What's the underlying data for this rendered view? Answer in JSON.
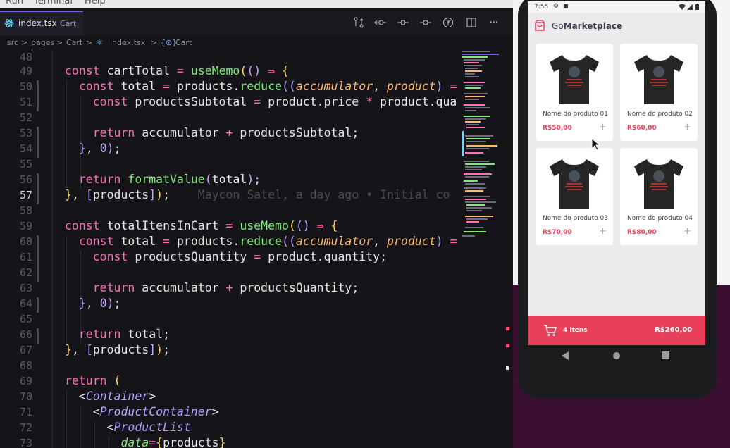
{
  "menu": [
    "Run",
    "Terminal",
    "Help"
  ],
  "tab": {
    "file_name": "index.tsx",
    "description": "Cart"
  },
  "toolbar_icons": [
    "git-compare-icon",
    "go-back-icon",
    "timeline-dot-icon",
    "timeline-dot-icon-2",
    "source-control-icon",
    "split-editor-icon",
    "more-actions-icon"
  ],
  "breadcrumb": [
    "src",
    ">",
    "pages",
    ">",
    "Cart",
    ">",
    "index.tsx",
    ">",
    "Cart"
  ],
  "current_line": 57,
  "blame": "Maycon Satel, a day ago • Initial co",
  "line_numbers": [
    "48",
    "49",
    "50",
    "51",
    "52",
    "53",
    "54",
    "55",
    "56",
    "57",
    "58",
    "59",
    "60",
    "61",
    "62",
    "63",
    "64",
    "65",
    "66",
    "67",
    "68",
    "69",
    "70",
    "71",
    "72",
    "73"
  ],
  "phone": {
    "status_time": "7:55",
    "app_title_light": "Go",
    "app_title_bold": "Marketplace",
    "products": [
      {
        "name": "Nome do produto 01",
        "price": "R$50,00"
      },
      {
        "name": "Nome do produto 02",
        "price": "R$60,00"
      },
      {
        "name": "Nome do produto 03",
        "price": "R$70,00"
      },
      {
        "name": "Nome do produto 04",
        "price": "R$80,00"
      }
    ],
    "cart_count": "4 itens",
    "cart_total": "R$260,00",
    "colors": {
      "accent": "#e83f5b",
      "title": "#3d3d4d"
    }
  }
}
